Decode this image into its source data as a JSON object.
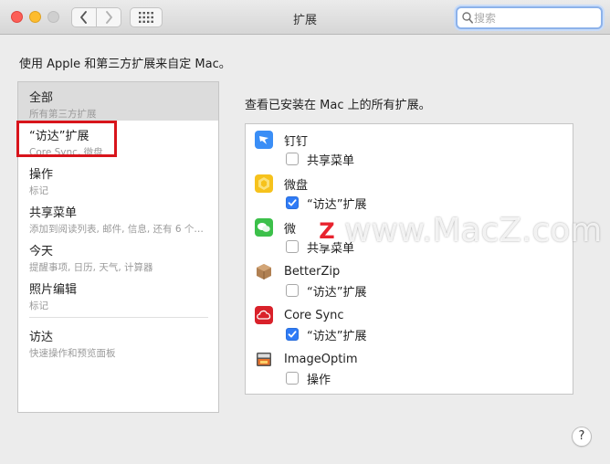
{
  "window": {
    "title": "扩展"
  },
  "search": {
    "placeholder": "搜索"
  },
  "subtitle": "使用 Apple 和第三方扩展来自定 Mac。",
  "sidebar": {
    "items": [
      {
        "title": "全部",
        "subtitle": "所有第三方扩展"
      },
      {
        "title": "“访达”扩展",
        "subtitle": "Core Sync, 微盘"
      },
      {
        "title": "操作",
        "subtitle": "标记"
      },
      {
        "title": "共享菜单",
        "subtitle": "添加到阅读列表, 邮件, 信息, 还有 6 个…"
      },
      {
        "title": "今天",
        "subtitle": "提醒事项, 日历, 天气, 计算器"
      },
      {
        "title": "照片编辑",
        "subtitle": "标记"
      },
      {
        "title": "访达",
        "subtitle": "快速操作和预览面板"
      }
    ]
  },
  "panel": {
    "label": "查看已安装在 Mac 上的所有扩展。",
    "apps": [
      {
        "name": "钉钉",
        "icon": "dingtalk-icon",
        "extension": "共享菜单",
        "checked": false
      },
      {
        "name": "微盘",
        "icon": "weipan-icon",
        "extension": "“访达”扩展",
        "checked": true
      },
      {
        "name": "微",
        "icon": "wechat-icon",
        "extension": "共享菜单",
        "checked": false
      },
      {
        "name": "BetterZip",
        "icon": "betterzip-icon",
        "extension": "“访达”扩展",
        "checked": false
      },
      {
        "name": "Core Sync",
        "icon": "core-sync-icon",
        "extension": "“访达”扩展",
        "checked": true
      },
      {
        "name": "ImageOptim",
        "icon": "imageoptim-icon",
        "extension": "操作",
        "checked": false
      }
    ]
  },
  "help": "?",
  "watermark": {
    "logo_letter": "Z",
    "text": "www.MacZ.com"
  },
  "colors": {
    "accent": "#2f7bf6",
    "highlight_box": "#d8141b",
    "selected_row": "#dcdcdc"
  }
}
